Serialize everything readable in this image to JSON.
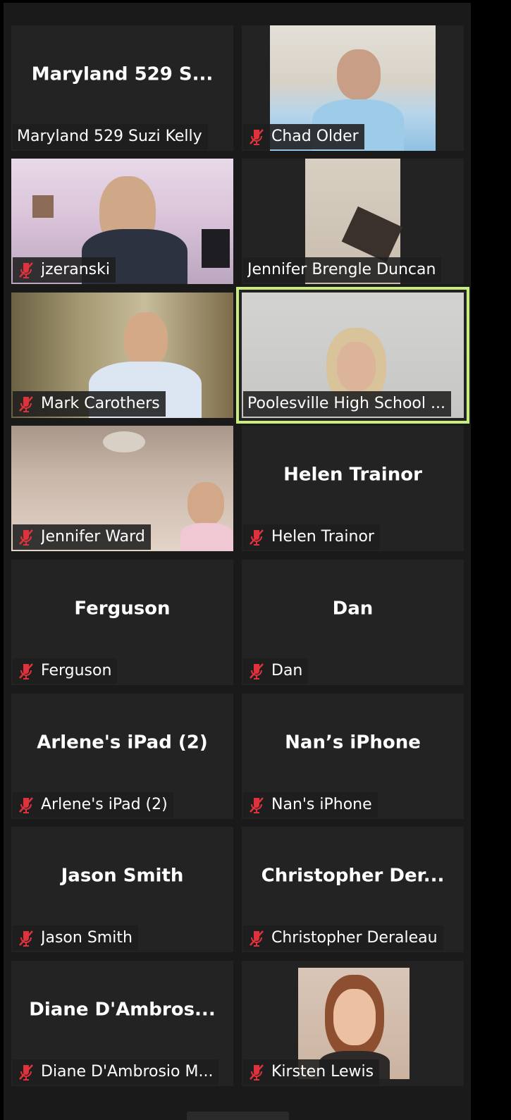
{
  "participants": [
    {
      "id": "p0",
      "tile_name": "Maryland 529 S...",
      "label": "Maryland 529 Suzi Kelly",
      "muted": false,
      "video": false
    },
    {
      "id": "p1",
      "tile_name": "",
      "label": "Chad Older",
      "muted": true,
      "video": true
    },
    {
      "id": "p2",
      "tile_name": "",
      "label": "jzeranski",
      "muted": true,
      "video": true
    },
    {
      "id": "p3",
      "tile_name": "",
      "label": "Jennifer Brengle Duncan",
      "muted": false,
      "video": true
    },
    {
      "id": "p4",
      "tile_name": "",
      "label": "Mark Carothers",
      "muted": true,
      "video": true
    },
    {
      "id": "p5",
      "tile_name": "",
      "label": "Poolesville High School ...",
      "muted": false,
      "video": true,
      "active_speaker": true
    },
    {
      "id": "p6",
      "tile_name": "",
      "label": "Jennifer Ward",
      "muted": true,
      "video": true
    },
    {
      "id": "p7",
      "tile_name": "Helen Trainor",
      "label": "Helen Trainor",
      "muted": true,
      "video": false
    },
    {
      "id": "p8",
      "tile_name": "Ferguson",
      "label": "Ferguson",
      "muted": true,
      "video": false
    },
    {
      "id": "p9",
      "tile_name": "Dan",
      "label": "Dan",
      "muted": true,
      "video": false
    },
    {
      "id": "p10",
      "tile_name": "Arlene's iPad (2)",
      "label": "Arlene's iPad (2)",
      "muted": true,
      "video": false
    },
    {
      "id": "p11",
      "tile_name": "Nan’s iPhone",
      "label": "Nan's iPhone",
      "muted": true,
      "video": false
    },
    {
      "id": "p12",
      "tile_name": "Jason Smith",
      "label": "Jason Smith",
      "muted": true,
      "video": false
    },
    {
      "id": "p13",
      "tile_name": "Christopher  Der...",
      "label": "Christopher Deraleau",
      "muted": true,
      "video": false
    },
    {
      "id": "p14",
      "tile_name": "Diane  D'Ambros...",
      "label": "Diane D'Ambrosio M...",
      "muted": true,
      "video": false
    },
    {
      "id": "p15",
      "tile_name": "",
      "label": "Kirsten Lewis",
      "muted": true,
      "video": true
    }
  ],
  "colors": {
    "tile_background": "#232323",
    "active_speaker_border": "#c9ec7e",
    "muted_icon": "#e0323c"
  },
  "icons": {
    "muted": "mic-muted-icon"
  }
}
